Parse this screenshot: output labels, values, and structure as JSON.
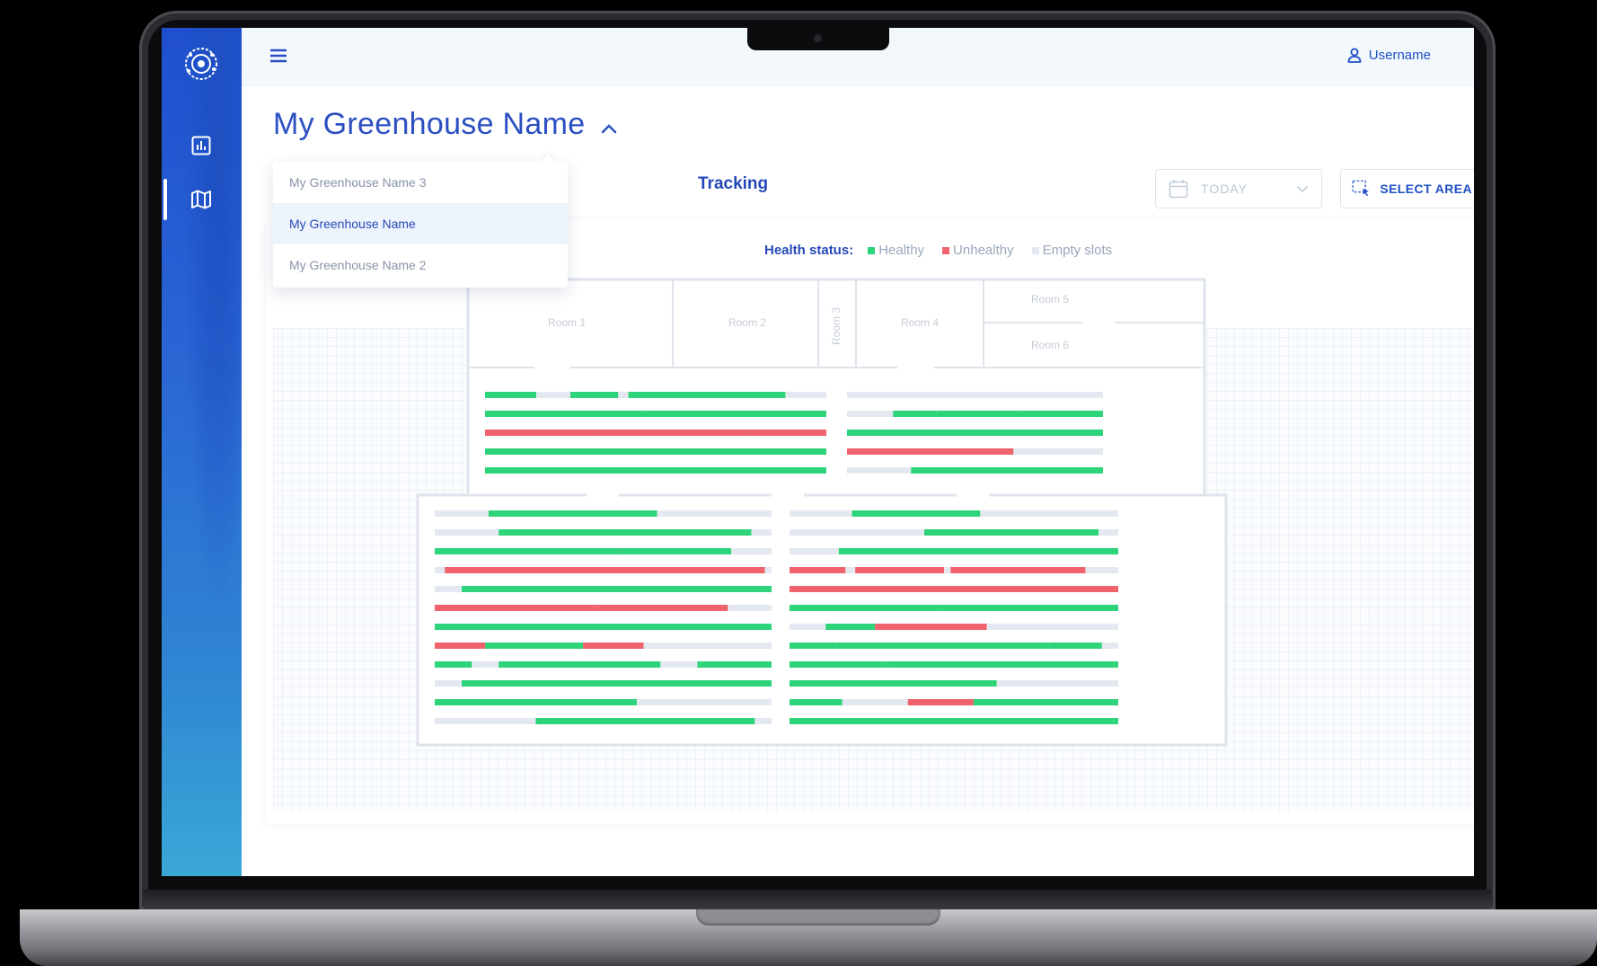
{
  "header": {
    "username": "Username"
  },
  "page": {
    "title": "My Greenhouse Name",
    "tab": "Tracking"
  },
  "dropdown": {
    "items": [
      "My Greenhouse Name 3",
      "My Greenhouse Name",
      "My Greenhouse Name 2"
    ],
    "selected": "My Greenhouse Name"
  },
  "toolbar": {
    "date": "TODAY",
    "select_area": "SELECT AREA"
  },
  "legend": {
    "label": "Health status:",
    "healthy": "Healthy",
    "unhealthy": "Unhealthy",
    "empty": "Empty slots"
  },
  "rooms": [
    "Room 1",
    "Room 2",
    "Room 3",
    "Room 4",
    "Room 5",
    "Room 6"
  ],
  "colors": {
    "healthy": "#2ed47a",
    "unhealthy": "#f0626c",
    "empty": "#e4e8f0",
    "accent": "#2b4fc1"
  },
  "icons": {
    "logo": "greenhouse-logo-icon",
    "menu": "hamburger-menu-icon",
    "user": "user-icon",
    "dashboard": "bar-chart-icon",
    "map": "map-icon",
    "chevron": "chevron-up-icon",
    "calendar": "calendar-icon",
    "select": "select-area-icon"
  },
  "zoom": {
    "in": "+",
    "out": "−"
  },
  "upper_rows": [
    [
      [
        0,
        0.15,
        "h"
      ],
      [
        0.25,
        0.39,
        "h"
      ],
      [
        0.42,
        0.88,
        "h"
      ]
    ],
    [
      [
        0,
        0.46,
        "h"
      ],
      [
        0.46,
        1,
        "h"
      ]
    ],
    [
      [
        0,
        0.33,
        "u"
      ],
      [
        0.33,
        0.78,
        "u"
      ],
      [
        0.78,
        1,
        "u"
      ]
    ],
    [
      [
        0,
        0.15,
        "h"
      ],
      [
        0.15,
        1,
        "h"
      ]
    ],
    [
      [
        0,
        1,
        "h"
      ]
    ],
    [],
    [
      [
        0.18,
        0.35,
        "h"
      ],
      [
        0.35,
        0.67,
        "h"
      ],
      [
        0.67,
        1,
        "h"
      ]
    ],
    [
      [
        0,
        1,
        "h"
      ]
    ],
    [
      [
        0,
        0.65,
        "u"
      ]
    ],
    [
      [
        0.25,
        1,
        "h"
      ]
    ]
  ],
  "lower_rows": [
    [
      [
        0.16,
        0.66,
        "h"
      ]
    ],
    [
      [
        0.19,
        0.94,
        "h"
      ]
    ],
    [
      [
        0,
        0.55,
        "h"
      ],
      [
        0.55,
        0.88,
        "h"
      ]
    ],
    [
      [
        0.03,
        0.26,
        "u"
      ],
      [
        0.26,
        0.82,
        "u"
      ],
      [
        0.82,
        0.98,
        "u"
      ]
    ],
    [
      [
        0.08,
        0.24,
        "h"
      ],
      [
        0.24,
        1,
        "h"
      ]
    ],
    [
      [
        0,
        0.16,
        "u"
      ],
      [
        0.16,
        0.49,
        "u"
      ],
      [
        0.49,
        0.87,
        "u"
      ]
    ],
    [
      [
        0,
        1,
        "h"
      ]
    ],
    [
      [
        0,
        0.15,
        "u"
      ],
      [
        0.15,
        0.44,
        "h"
      ],
      [
        0.44,
        0.62,
        "u"
      ]
    ],
    [
      [
        0,
        0.11,
        "h"
      ],
      [
        0.19,
        0.67,
        "h"
      ],
      [
        0.78,
        1,
        "h"
      ]
    ],
    [
      [
        0.08,
        0.6,
        "h"
      ],
      [
        0.6,
        1,
        "h"
      ]
    ],
    [
      [
        0,
        0.6,
        "h"
      ]
    ],
    [
      [
        0.3,
        0.95,
        "h"
      ]
    ]
  ],
  "lower_rows_right": [
    [
      [
        0.19,
        0.58,
        "h"
      ]
    ],
    [
      [
        0.41,
        0.94,
        "h"
      ]
    ],
    [
      [
        0.15,
        0.6,
        "h"
      ],
      [
        0.6,
        1,
        "h"
      ]
    ],
    [
      [
        0,
        0.17,
        "u"
      ],
      [
        0.2,
        0.47,
        "u"
      ],
      [
        0.49,
        0.9,
        "u"
      ]
    ],
    [
      [
        0,
        1,
        "u"
      ]
    ],
    [
      [
        0,
        0.46,
        "h"
      ],
      [
        0.46,
        1,
        "h"
      ]
    ],
    [
      [
        0.11,
        0.26,
        "h"
      ],
      [
        0.26,
        0.6,
        "u"
      ]
    ],
    [
      [
        0,
        0.14,
        "h"
      ],
      [
        0.14,
        0.79,
        "h"
      ],
      [
        0.79,
        0.95,
        "h"
      ]
    ],
    [
      [
        0,
        0.3,
        "h"
      ],
      [
        0.3,
        1,
        "h"
      ]
    ],
    [
      [
        0,
        0.63,
        "h"
      ]
    ],
    [
      [
        0,
        0.16,
        "h"
      ],
      [
        0.36,
        0.56,
        "u"
      ],
      [
        0.56,
        1,
        "h"
      ]
    ],
    [
      [
        0,
        1,
        "h"
      ]
    ]
  ]
}
